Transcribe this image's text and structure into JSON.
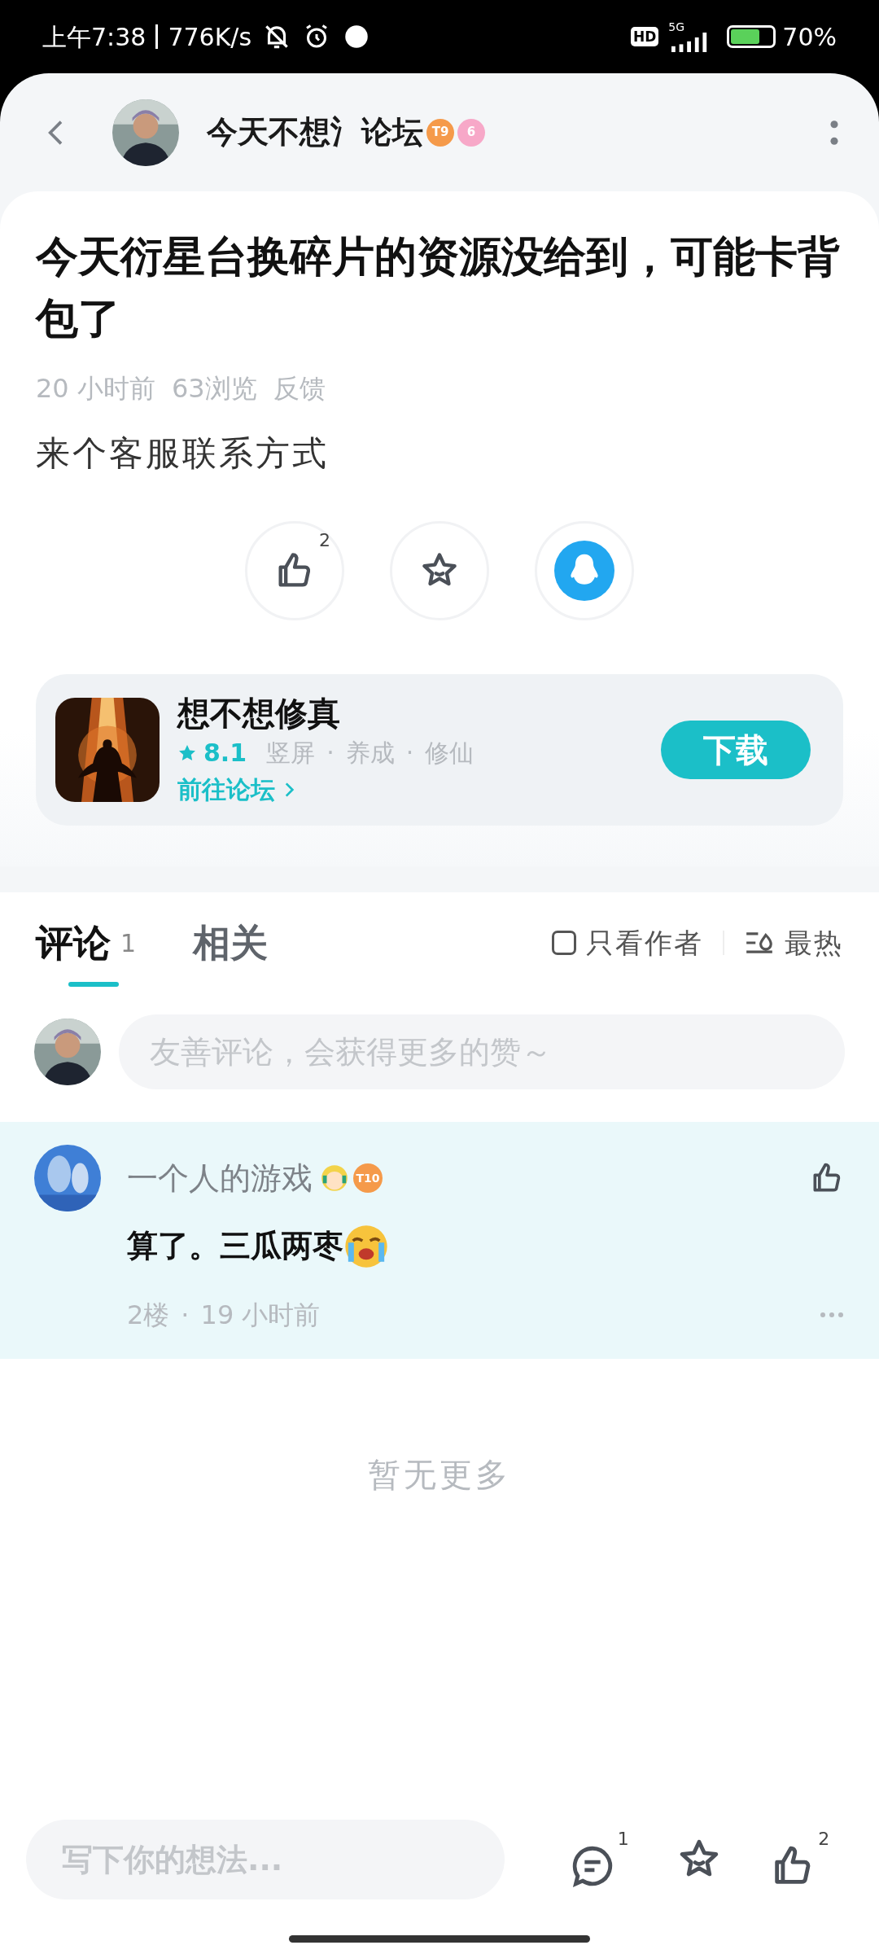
{
  "status_bar": {
    "time": "上午7:38",
    "speed": "776K/s",
    "hd": "HD",
    "network": "5G",
    "battery": "70%"
  },
  "header": {
    "title": "今天不想氵论坛",
    "badges": [
      {
        "text": "T9",
        "color": "#f59a4a"
      },
      {
        "text": "6",
        "color": "#f7a8c8"
      }
    ]
  },
  "post": {
    "title": "今天衍星台换碎片的资源没给到，可能卡背包了",
    "meta": [
      "20 小时前",
      "63浏览",
      "反馈"
    ],
    "body": "来个客服联系方式"
  },
  "actions": [
    {
      "kind": "like",
      "count": "2"
    },
    {
      "kind": "favorite"
    },
    {
      "kind": "qq"
    }
  ],
  "app_card": {
    "name": "想不想修真",
    "rating": "8.1",
    "tags": [
      "竖屏",
      "养成",
      "修仙"
    ],
    "separator": "·",
    "forum_link": "前往论坛",
    "button": "下载"
  },
  "tabs": [
    {
      "label": "评论",
      "count": "1",
      "selected": true
    },
    {
      "label": "相关",
      "selected": false
    }
  ],
  "filters": {
    "author_only": {
      "label": "只看作者",
      "checked": false
    },
    "sort": "最热"
  },
  "comment_input": {
    "placeholder": "友善评论，会获得更多的赞～"
  },
  "comments": [
    {
      "user": "一个人的游戏",
      "badge": "T10",
      "text": "算了。三瓜两枣",
      "floor": "2楼",
      "separator": "·",
      "time": "19 小时前"
    }
  ],
  "end_text": "暂无更多",
  "bottom_bar": {
    "placeholder": "写下你的想法...",
    "comment_count": "1",
    "like_count": "2"
  }
}
